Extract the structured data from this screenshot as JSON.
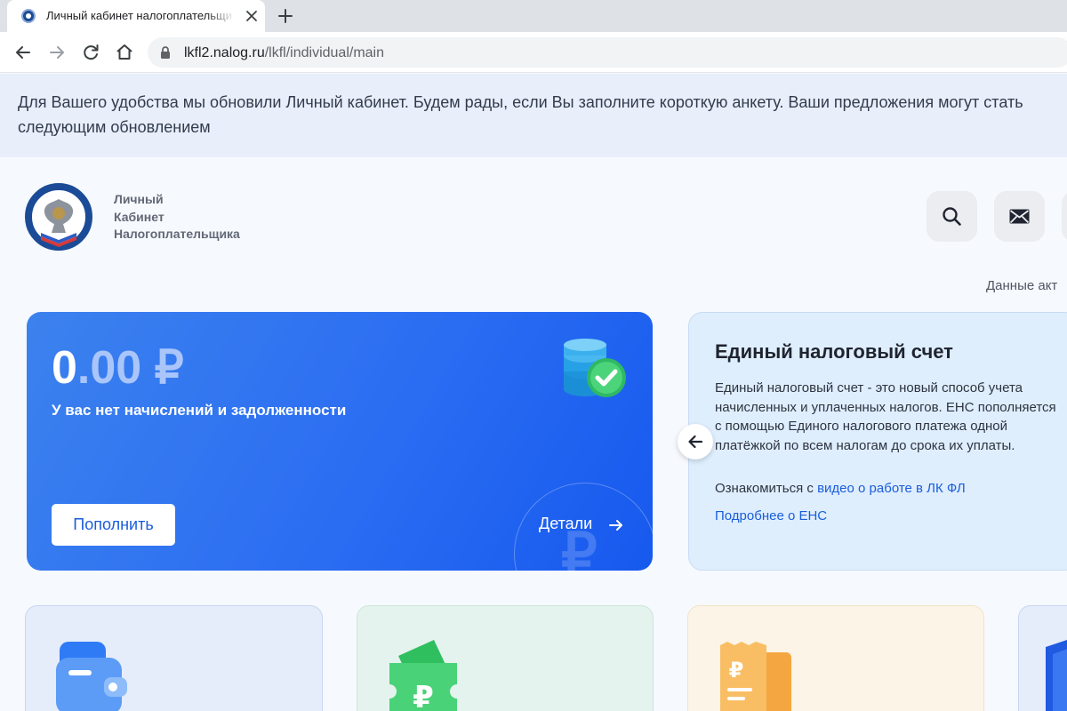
{
  "browser": {
    "tab_title": "Личный кабинет налогоплательщика",
    "url_host": "lkfl2.nalog.ru",
    "url_path": "/lkfl/individual/main",
    "icons": [
      "favicon-icon",
      "close-icon",
      "plus-icon",
      "back-icon",
      "forward-icon",
      "reload-icon",
      "home-icon",
      "lock-icon"
    ]
  },
  "banner": {
    "text": "Для Вашего удобства мы обновили Личный кабинет. Будем рады, если Вы заполните короткую анкету. Ваши предложения могут стать следующим обновлением"
  },
  "header": {
    "title_line1": "Личный",
    "title_line2": "Кабинет",
    "title_line3": "Налогоплательщика",
    "logo_icon": "fns-emblem-icon",
    "buttons": [
      "search-icon",
      "mail-icon"
    ]
  },
  "data_actual_label": "Данные акт",
  "balance": {
    "amount_int": "0",
    "amount_frac": ".00",
    "currency": " ₽",
    "status": "У вас нет начислений и задолженности",
    "topup_label": "Пополнить",
    "details_label": "Детали",
    "accent_color": "#2b6df2"
  },
  "ens": {
    "title": "Единый налоговый счет",
    "description": "Единый налоговый счет - это новый способ учета начисленных и уплаченных налогов. ЕНС пополняется с помощью Единого налогового платежа одной платёжкой по всем налогам до срока их уплаты.",
    "video_prefix": "Ознакомиться с ",
    "video_link": "видео о работе в ЛК ФЛ",
    "more_link": "Подробнее о ЕНС"
  },
  "bottom_cards": {
    "icons": [
      "wallet-icon",
      "ruble-ticket-icon",
      "receipt-icon",
      "shield-icon"
    ]
  }
}
